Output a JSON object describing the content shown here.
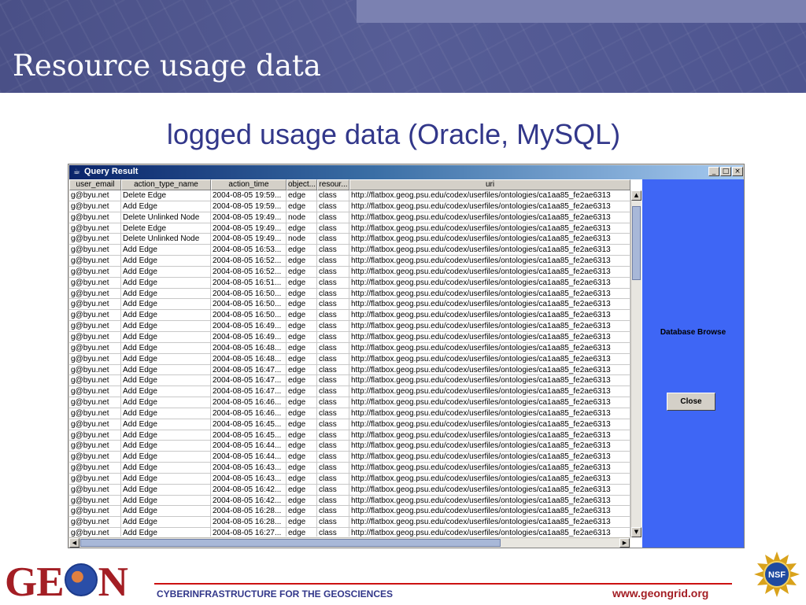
{
  "header": {
    "title": "Resource usage data"
  },
  "subtitle": "logged usage data (Oracle, MySQL)",
  "window": {
    "title": "Query Result",
    "controls": {
      "minimize": "_",
      "maximize": "□",
      "close": "×"
    }
  },
  "table": {
    "columns": [
      "user_email",
      "action_type_name",
      "action_time",
      "object...",
      "resour...",
      "uri"
    ],
    "rows": [
      [
        "g@byu.net",
        "Delete Edge",
        "2004-08-05 19:59...",
        "edge",
        "class",
        "http://flatbox.geog.psu.edu/codex/userfiles/ontologies/ca1aa85_fe2ae6313"
      ],
      [
        "g@byu.net",
        "Add Edge",
        "2004-08-05 19:59...",
        "edge",
        "class",
        "http://flatbox.geog.psu.edu/codex/userfiles/ontologies/ca1aa85_fe2ae6313"
      ],
      [
        "g@byu.net",
        "Delete Unlinked Node",
        "2004-08-05 19:49...",
        "node",
        "class",
        "http://flatbox.geog.psu.edu/codex/userfiles/ontologies/ca1aa85_fe2ae6313"
      ],
      [
        "g@byu.net",
        "Delete Edge",
        "2004-08-05 19:49...",
        "edge",
        "class",
        "http://flatbox.geog.psu.edu/codex/userfiles/ontologies/ca1aa85_fe2ae6313"
      ],
      [
        "g@byu.net",
        "Delete Unlinked Node",
        "2004-08-05 19:49...",
        "node",
        "class",
        "http://flatbox.geog.psu.edu/codex/userfiles/ontologies/ca1aa85_fe2ae6313"
      ],
      [
        "g@byu.net",
        "Add Edge",
        "2004-08-05 16:53...",
        "edge",
        "class",
        "http://flatbox.geog.psu.edu/codex/userfiles/ontologies/ca1aa85_fe2ae6313"
      ],
      [
        "g@byu.net",
        "Add Edge",
        "2004-08-05 16:52...",
        "edge",
        "class",
        "http://flatbox.geog.psu.edu/codex/userfiles/ontologies/ca1aa85_fe2ae6313"
      ],
      [
        "g@byu.net",
        "Add Edge",
        "2004-08-05 16:52...",
        "edge",
        "class",
        "http://flatbox.geog.psu.edu/codex/userfiles/ontologies/ca1aa85_fe2ae6313"
      ],
      [
        "g@byu.net",
        "Add Edge",
        "2004-08-05 16:51...",
        "edge",
        "class",
        "http://flatbox.geog.psu.edu/codex/userfiles/ontologies/ca1aa85_fe2ae6313"
      ],
      [
        "g@byu.net",
        "Add Edge",
        "2004-08-05 16:50...",
        "edge",
        "class",
        "http://flatbox.geog.psu.edu/codex/userfiles/ontologies/ca1aa85_fe2ae6313"
      ],
      [
        "g@byu.net",
        "Add Edge",
        "2004-08-05 16:50...",
        "edge",
        "class",
        "http://flatbox.geog.psu.edu/codex/userfiles/ontologies/ca1aa85_fe2ae6313"
      ],
      [
        "g@byu.net",
        "Add Edge",
        "2004-08-05 16:50...",
        "edge",
        "class",
        "http://flatbox.geog.psu.edu/codex/userfiles/ontologies/ca1aa85_fe2ae6313"
      ],
      [
        "g@byu.net",
        "Add Edge",
        "2004-08-05 16:49...",
        "edge",
        "class",
        "http://flatbox.geog.psu.edu/codex/userfiles/ontologies/ca1aa85_fe2ae6313"
      ],
      [
        "g@byu.net",
        "Add Edge",
        "2004-08-05 16:49...",
        "edge",
        "class",
        "http://flatbox.geog.psu.edu/codex/userfiles/ontologies/ca1aa85_fe2ae6313"
      ],
      [
        "g@byu.net",
        "Add Edge",
        "2004-08-05 16:48...",
        "edge",
        "class",
        "http://flatbox.geog.psu.edu/codex/userfiles/ontologies/ca1aa85_fe2ae6313"
      ],
      [
        "g@byu.net",
        "Add Edge",
        "2004-08-05 16:48...",
        "edge",
        "class",
        "http://flatbox.geog.psu.edu/codex/userfiles/ontologies/ca1aa85_fe2ae6313"
      ],
      [
        "g@byu.net",
        "Add Edge",
        "2004-08-05 16:47...",
        "edge",
        "class",
        "http://flatbox.geog.psu.edu/codex/userfiles/ontologies/ca1aa85_fe2ae6313"
      ],
      [
        "g@byu.net",
        "Add Edge",
        "2004-08-05 16:47...",
        "edge",
        "class",
        "http://flatbox.geog.psu.edu/codex/userfiles/ontologies/ca1aa85_fe2ae6313"
      ],
      [
        "g@byu.net",
        "Add Edge",
        "2004-08-05 16:47...",
        "edge",
        "class",
        "http://flatbox.geog.psu.edu/codex/userfiles/ontologies/ca1aa85_fe2ae6313"
      ],
      [
        "g@byu.net",
        "Add Edge",
        "2004-08-05 16:46...",
        "edge",
        "class",
        "http://flatbox.geog.psu.edu/codex/userfiles/ontologies/ca1aa85_fe2ae6313"
      ],
      [
        "g@byu.net",
        "Add Edge",
        "2004-08-05 16:46...",
        "edge",
        "class",
        "http://flatbox.geog.psu.edu/codex/userfiles/ontologies/ca1aa85_fe2ae6313"
      ],
      [
        "g@byu.net",
        "Add Edge",
        "2004-08-05 16:45...",
        "edge",
        "class",
        "http://flatbox.geog.psu.edu/codex/userfiles/ontologies/ca1aa85_fe2ae6313"
      ],
      [
        "g@byu.net",
        "Add Edge",
        "2004-08-05 16:45...",
        "edge",
        "class",
        "http://flatbox.geog.psu.edu/codex/userfiles/ontologies/ca1aa85_fe2ae6313"
      ],
      [
        "g@byu.net",
        "Add Edge",
        "2004-08-05 16:44...",
        "edge",
        "class",
        "http://flatbox.geog.psu.edu/codex/userfiles/ontologies/ca1aa85_fe2ae6313"
      ],
      [
        "g@byu.net",
        "Add Edge",
        "2004-08-05 16:44...",
        "edge",
        "class",
        "http://flatbox.geog.psu.edu/codex/userfiles/ontologies/ca1aa85_fe2ae6313"
      ],
      [
        "g@byu.net",
        "Add Edge",
        "2004-08-05 16:43...",
        "edge",
        "class",
        "http://flatbox.geog.psu.edu/codex/userfiles/ontologies/ca1aa85_fe2ae6313"
      ],
      [
        "g@byu.net",
        "Add Edge",
        "2004-08-05 16:43...",
        "edge",
        "class",
        "http://flatbox.geog.psu.edu/codex/userfiles/ontologies/ca1aa85_fe2ae6313"
      ],
      [
        "g@byu.net",
        "Add Edge",
        "2004-08-05 16:42...",
        "edge",
        "class",
        "http://flatbox.geog.psu.edu/codex/userfiles/ontologies/ca1aa85_fe2ae6313"
      ],
      [
        "g@byu.net",
        "Add Edge",
        "2004-08-05 16:42...",
        "edge",
        "class",
        "http://flatbox.geog.psu.edu/codex/userfiles/ontologies/ca1aa85_fe2ae6313"
      ],
      [
        "g@byu.net",
        "Add Edge",
        "2004-08-05 16:28...",
        "edge",
        "class",
        "http://flatbox.geog.psu.edu/codex/userfiles/ontologies/ca1aa85_fe2ae6313"
      ],
      [
        "g@byu.net",
        "Add Edge",
        "2004-08-05 16:28...",
        "edge",
        "class",
        "http://flatbox.geog.psu.edu/codex/userfiles/ontologies/ca1aa85_fe2ae6313"
      ],
      [
        "g@byu.net",
        "Add Edge",
        "2004-08-05 16:27...",
        "edge",
        "class",
        "http://flatbox.geog.psu.edu/codex/userfiles/ontologies/ca1aa85_fe2ae6313"
      ]
    ]
  },
  "side_panel": {
    "label": "Database Browse",
    "close_label": "Close"
  },
  "footer": {
    "logo_left": "GE",
    "logo_right": "N",
    "tagline": "CYBERINFRASTRUCTURE FOR THE GEOSCIENCES",
    "url": "www.geongrid.org",
    "nsf_label": "NSF"
  },
  "colors": {
    "header_bg": "#4e5590",
    "title_text": "#32378a",
    "side_panel_bg": "#3e66f5",
    "brand_red": "#a31e24"
  },
  "icons": {
    "app": "java-cup-icon",
    "nsf": "nsf-seal-icon",
    "globe": "globe-icon"
  }
}
